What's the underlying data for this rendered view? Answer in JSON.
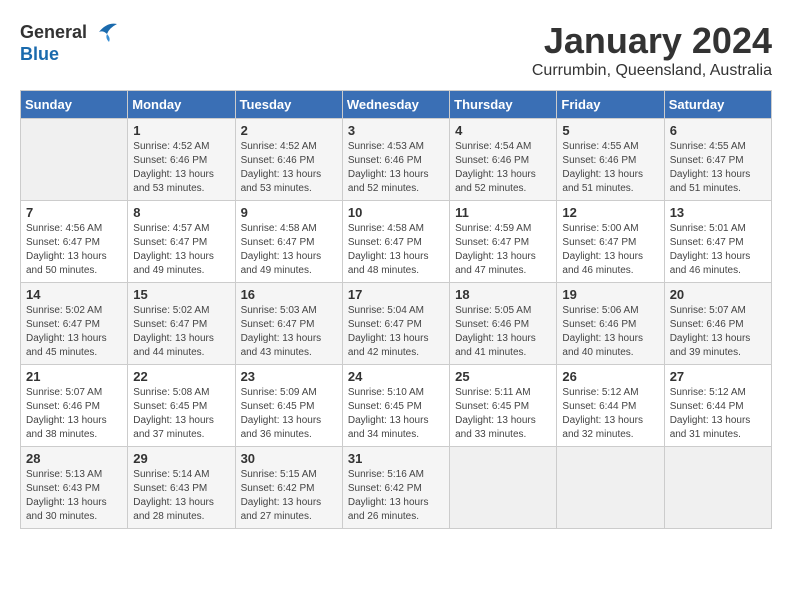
{
  "logo": {
    "general": "General",
    "blue": "Blue"
  },
  "title": "January 2024",
  "location": "Currumbin, Queensland, Australia",
  "days_header": [
    "Sunday",
    "Monday",
    "Tuesday",
    "Wednesday",
    "Thursday",
    "Friday",
    "Saturday"
  ],
  "weeks": [
    [
      {
        "day": "",
        "sunrise": "",
        "sunset": "",
        "daylight": ""
      },
      {
        "day": "1",
        "sunrise": "Sunrise: 4:52 AM",
        "sunset": "Sunset: 6:46 PM",
        "daylight": "Daylight: 13 hours and 53 minutes."
      },
      {
        "day": "2",
        "sunrise": "Sunrise: 4:52 AM",
        "sunset": "Sunset: 6:46 PM",
        "daylight": "Daylight: 13 hours and 53 minutes."
      },
      {
        "day": "3",
        "sunrise": "Sunrise: 4:53 AM",
        "sunset": "Sunset: 6:46 PM",
        "daylight": "Daylight: 13 hours and 52 minutes."
      },
      {
        "day": "4",
        "sunrise": "Sunrise: 4:54 AM",
        "sunset": "Sunset: 6:46 PM",
        "daylight": "Daylight: 13 hours and 52 minutes."
      },
      {
        "day": "5",
        "sunrise": "Sunrise: 4:55 AM",
        "sunset": "Sunset: 6:46 PM",
        "daylight": "Daylight: 13 hours and 51 minutes."
      },
      {
        "day": "6",
        "sunrise": "Sunrise: 4:55 AM",
        "sunset": "Sunset: 6:47 PM",
        "daylight": "Daylight: 13 hours and 51 minutes."
      }
    ],
    [
      {
        "day": "7",
        "sunrise": "Sunrise: 4:56 AM",
        "sunset": "Sunset: 6:47 PM",
        "daylight": "Daylight: 13 hours and 50 minutes."
      },
      {
        "day": "8",
        "sunrise": "Sunrise: 4:57 AM",
        "sunset": "Sunset: 6:47 PM",
        "daylight": "Daylight: 13 hours and 49 minutes."
      },
      {
        "day": "9",
        "sunrise": "Sunrise: 4:58 AM",
        "sunset": "Sunset: 6:47 PM",
        "daylight": "Daylight: 13 hours and 49 minutes."
      },
      {
        "day": "10",
        "sunrise": "Sunrise: 4:58 AM",
        "sunset": "Sunset: 6:47 PM",
        "daylight": "Daylight: 13 hours and 48 minutes."
      },
      {
        "day": "11",
        "sunrise": "Sunrise: 4:59 AM",
        "sunset": "Sunset: 6:47 PM",
        "daylight": "Daylight: 13 hours and 47 minutes."
      },
      {
        "day": "12",
        "sunrise": "Sunrise: 5:00 AM",
        "sunset": "Sunset: 6:47 PM",
        "daylight": "Daylight: 13 hours and 46 minutes."
      },
      {
        "day": "13",
        "sunrise": "Sunrise: 5:01 AM",
        "sunset": "Sunset: 6:47 PM",
        "daylight": "Daylight: 13 hours and 46 minutes."
      }
    ],
    [
      {
        "day": "14",
        "sunrise": "Sunrise: 5:02 AM",
        "sunset": "Sunset: 6:47 PM",
        "daylight": "Daylight: 13 hours and 45 minutes."
      },
      {
        "day": "15",
        "sunrise": "Sunrise: 5:02 AM",
        "sunset": "Sunset: 6:47 PM",
        "daylight": "Daylight: 13 hours and 44 minutes."
      },
      {
        "day": "16",
        "sunrise": "Sunrise: 5:03 AM",
        "sunset": "Sunset: 6:47 PM",
        "daylight": "Daylight: 13 hours and 43 minutes."
      },
      {
        "day": "17",
        "sunrise": "Sunrise: 5:04 AM",
        "sunset": "Sunset: 6:47 PM",
        "daylight": "Daylight: 13 hours and 42 minutes."
      },
      {
        "day": "18",
        "sunrise": "Sunrise: 5:05 AM",
        "sunset": "Sunset: 6:46 PM",
        "daylight": "Daylight: 13 hours and 41 minutes."
      },
      {
        "day": "19",
        "sunrise": "Sunrise: 5:06 AM",
        "sunset": "Sunset: 6:46 PM",
        "daylight": "Daylight: 13 hours and 40 minutes."
      },
      {
        "day": "20",
        "sunrise": "Sunrise: 5:07 AM",
        "sunset": "Sunset: 6:46 PM",
        "daylight": "Daylight: 13 hours and 39 minutes."
      }
    ],
    [
      {
        "day": "21",
        "sunrise": "Sunrise: 5:07 AM",
        "sunset": "Sunset: 6:46 PM",
        "daylight": "Daylight: 13 hours and 38 minutes."
      },
      {
        "day": "22",
        "sunrise": "Sunrise: 5:08 AM",
        "sunset": "Sunset: 6:45 PM",
        "daylight": "Daylight: 13 hours and 37 minutes."
      },
      {
        "day": "23",
        "sunrise": "Sunrise: 5:09 AM",
        "sunset": "Sunset: 6:45 PM",
        "daylight": "Daylight: 13 hours and 36 minutes."
      },
      {
        "day": "24",
        "sunrise": "Sunrise: 5:10 AM",
        "sunset": "Sunset: 6:45 PM",
        "daylight": "Daylight: 13 hours and 34 minutes."
      },
      {
        "day": "25",
        "sunrise": "Sunrise: 5:11 AM",
        "sunset": "Sunset: 6:45 PM",
        "daylight": "Daylight: 13 hours and 33 minutes."
      },
      {
        "day": "26",
        "sunrise": "Sunrise: 5:12 AM",
        "sunset": "Sunset: 6:44 PM",
        "daylight": "Daylight: 13 hours and 32 minutes."
      },
      {
        "day": "27",
        "sunrise": "Sunrise: 5:12 AM",
        "sunset": "Sunset: 6:44 PM",
        "daylight": "Daylight: 13 hours and 31 minutes."
      }
    ],
    [
      {
        "day": "28",
        "sunrise": "Sunrise: 5:13 AM",
        "sunset": "Sunset: 6:43 PM",
        "daylight": "Daylight: 13 hours and 30 minutes."
      },
      {
        "day": "29",
        "sunrise": "Sunrise: 5:14 AM",
        "sunset": "Sunset: 6:43 PM",
        "daylight": "Daylight: 13 hours and 28 minutes."
      },
      {
        "day": "30",
        "sunrise": "Sunrise: 5:15 AM",
        "sunset": "Sunset: 6:42 PM",
        "daylight": "Daylight: 13 hours and 27 minutes."
      },
      {
        "day": "31",
        "sunrise": "Sunrise: 5:16 AM",
        "sunset": "Sunset: 6:42 PM",
        "daylight": "Daylight: 13 hours and 26 minutes."
      },
      {
        "day": "",
        "sunrise": "",
        "sunset": "",
        "daylight": ""
      },
      {
        "day": "",
        "sunrise": "",
        "sunset": "",
        "daylight": ""
      },
      {
        "day": "",
        "sunrise": "",
        "sunset": "",
        "daylight": ""
      }
    ]
  ]
}
